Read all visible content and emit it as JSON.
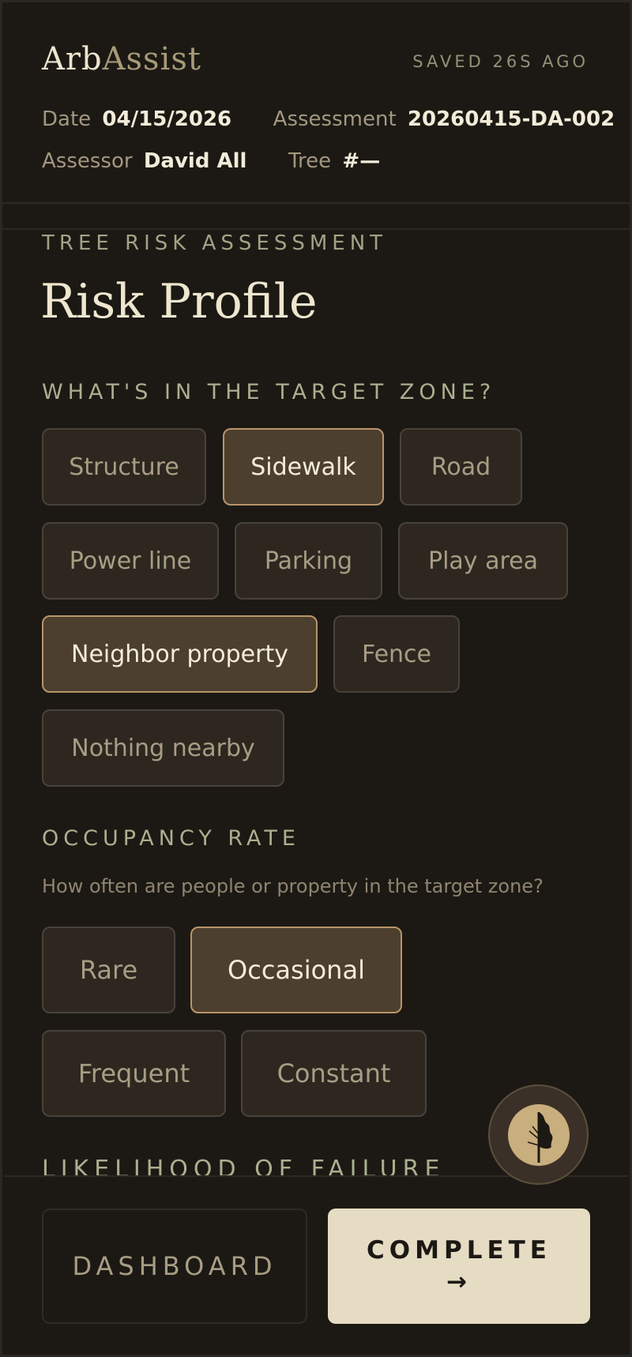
{
  "header": {
    "brand_part1": "Arb",
    "brand_part2": "Assist",
    "saved_status": "SAVED 26S AGO",
    "date_label": "Date",
    "date_value": "04/15/2026",
    "assessment_label": "Assessment",
    "assessment_value": "20260415-DA-002",
    "assessor_label": "Assessor",
    "assessor_value": "David All",
    "tree_label": "Tree",
    "tree_value": "#—"
  },
  "page": {
    "eyebrow": "TREE RISK ASSESSMENT",
    "title": "Risk Profile"
  },
  "target_zone": {
    "heading": "WHAT'S IN THE TARGET ZONE?",
    "options": [
      {
        "label": "Structure",
        "selected": false
      },
      {
        "label": "Sidewalk",
        "selected": true
      },
      {
        "label": "Road",
        "selected": false
      },
      {
        "label": "Power line",
        "selected": false
      },
      {
        "label": "Parking",
        "selected": false
      },
      {
        "label": "Play area",
        "selected": false
      },
      {
        "label": "Neighbor property",
        "selected": true
      },
      {
        "label": "Fence",
        "selected": false
      },
      {
        "label": "Nothing nearby",
        "selected": false
      }
    ]
  },
  "occupancy": {
    "heading": "OCCUPANCY RATE",
    "subtitle": "How often are people or property in the target zone?",
    "options": [
      {
        "label": "Rare",
        "selected": false
      },
      {
        "label": "Occasional",
        "selected": true
      },
      {
        "label": "Frequent",
        "selected": false
      },
      {
        "label": "Constant",
        "selected": false
      }
    ]
  },
  "next_section": {
    "heading": "LIKELIHOOD OF FAILURE"
  },
  "fab": {
    "icon": "tree-icon"
  },
  "footer": {
    "dashboard_label": "DASHBOARD",
    "complete_label": "COMPLETE",
    "complete_arrow": "→"
  },
  "colors": {
    "background": "#1c1914",
    "chip": "#2d2720",
    "chip_selected": "#4c3f2e",
    "chip_selected_border": "#b8956a",
    "accent_text": "#a9b08f",
    "primary_button": "#e5dcc3"
  }
}
